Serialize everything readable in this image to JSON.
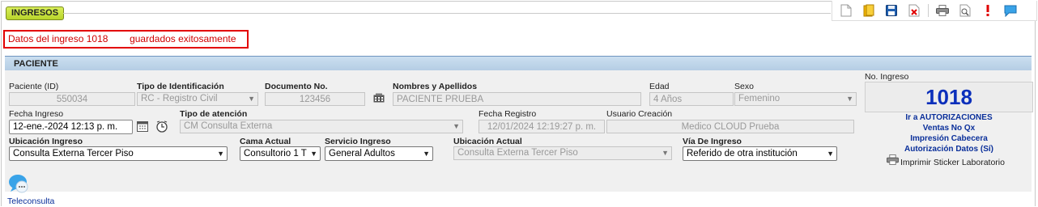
{
  "tab": {
    "label": "INGRESOS"
  },
  "toolbar": {
    "buttons": [
      "new-document-icon",
      "folder-icon",
      "save-icon",
      "cancel-document-icon",
      "print-icon",
      "print-preview-icon",
      "alert-icon",
      "chat-icon"
    ]
  },
  "message": {
    "text": "Datos del ingreso 1018        guardados exitosamente"
  },
  "section": {
    "title": "PACIENTE"
  },
  "fields": {
    "paciente_id": {
      "label": "Paciente (ID)",
      "value": "550034"
    },
    "tipo_identificacion": {
      "label": "Tipo de Identificación",
      "value": "RC - Registro Civil"
    },
    "documento": {
      "label": "Documento No.",
      "value": "123456"
    },
    "nombres": {
      "label": "Nombres y Apellidos",
      "value": "PACIENTE  PRUEBA"
    },
    "edad": {
      "label": "Edad",
      "value": "4  Años"
    },
    "sexo": {
      "label": "Sexo",
      "value": "Femenino"
    },
    "fecha_ingreso": {
      "label": "Fecha Ingreso",
      "value": "12-ene.-2024 12:13 p. m."
    },
    "tipo_atencion": {
      "label": "Tipo de atención",
      "value": "CM Consulta Externa"
    },
    "fecha_registro": {
      "label": "Fecha Registro",
      "value": "12/01/2024 12:19:27 p. m."
    },
    "usuario_creacion": {
      "label": "Usuario Creación",
      "value": "Medico CLOUD Prueba"
    },
    "ubicacion_ingreso": {
      "label": "Ubicación Ingreso",
      "value": "Consulta Externa Tercer Piso"
    },
    "cama_actual": {
      "label": "Cama Actual",
      "value": "Consultorio 1 T"
    },
    "servicio_ingreso": {
      "label": "Servicio Ingreso",
      "value": "General Adultos"
    },
    "ubicacion_actual": {
      "label": "Ubicación Actual",
      "value": "Consulta Externa Tercer Piso"
    },
    "via_ingreso": {
      "label": "Vía De Ingreso",
      "value": "Referido de otra institución"
    }
  },
  "ingreso": {
    "label": "No. Ingreso",
    "value": "1018"
  },
  "links": {
    "autorizaciones": "Ir a AUTORIZACIONES",
    "ventas": "Ventas No Qx",
    "impresion": "Impresión Cabecera",
    "autorizacion_datos": "Autorización Datos (Sí)",
    "sticker": "Imprimir Sticker Laboratorio"
  },
  "teleconsulta": {
    "label": "Teleconsulta"
  },
  "colors": {
    "accent": "#0b2fbb",
    "alert": "#e30000",
    "tab": "#c8e03a",
    "section": "#c4d8ec"
  }
}
